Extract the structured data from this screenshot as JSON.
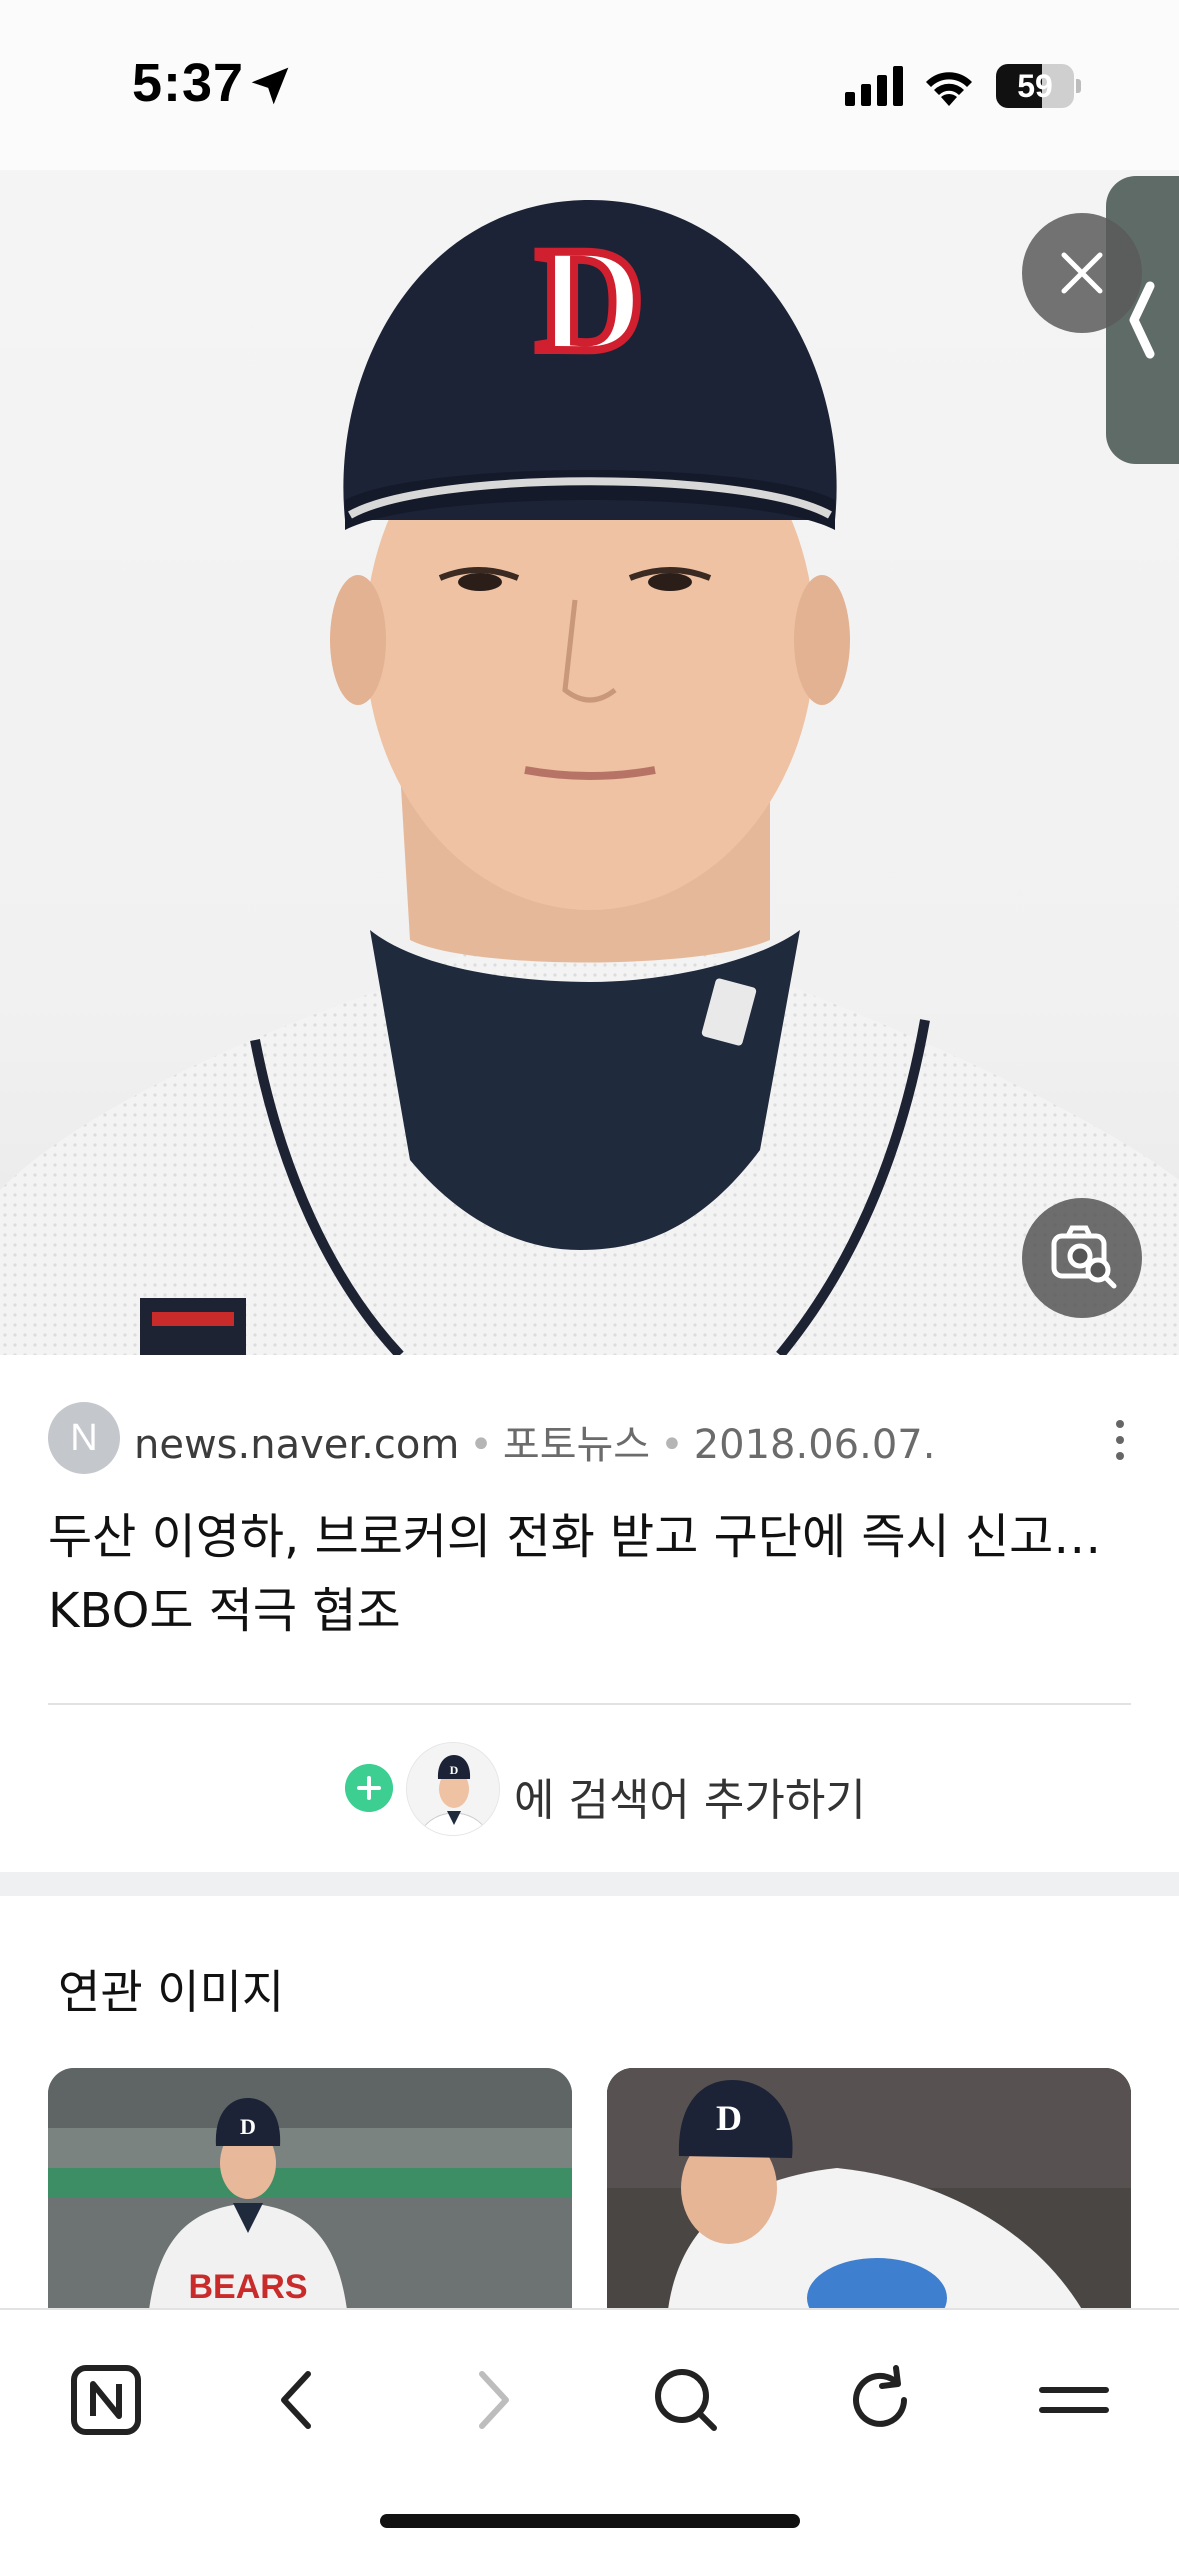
{
  "status_bar": {
    "time": "5:37",
    "battery_percent": 59,
    "battery_label": "59"
  },
  "source": {
    "badge_letter": "N",
    "domain": "news.naver.com",
    "category": "포토뉴스",
    "date": "2018.06.07.",
    "separator": "•"
  },
  "headline": "두산 이영하, 브로커의 전화 받고 구단에 즉시 신고… KBO도 적극 협조",
  "add_search": {
    "label": "에 검색어 추가하기"
  },
  "related": {
    "title": "연관 이미지"
  },
  "icons": {
    "close": "close-icon",
    "side_handle": "chevron-left-icon",
    "lens": "image-search-icon",
    "more": "more-vertical-icon",
    "naver_home": "naver-n-icon",
    "back": "chevron-left-icon",
    "forward": "chevron-right-icon",
    "search": "search-icon",
    "refresh": "refresh-icon",
    "menu": "menu-icon"
  },
  "colors": {
    "add_accent": "#3dcf92",
    "disabled": "#bdbdbd"
  }
}
